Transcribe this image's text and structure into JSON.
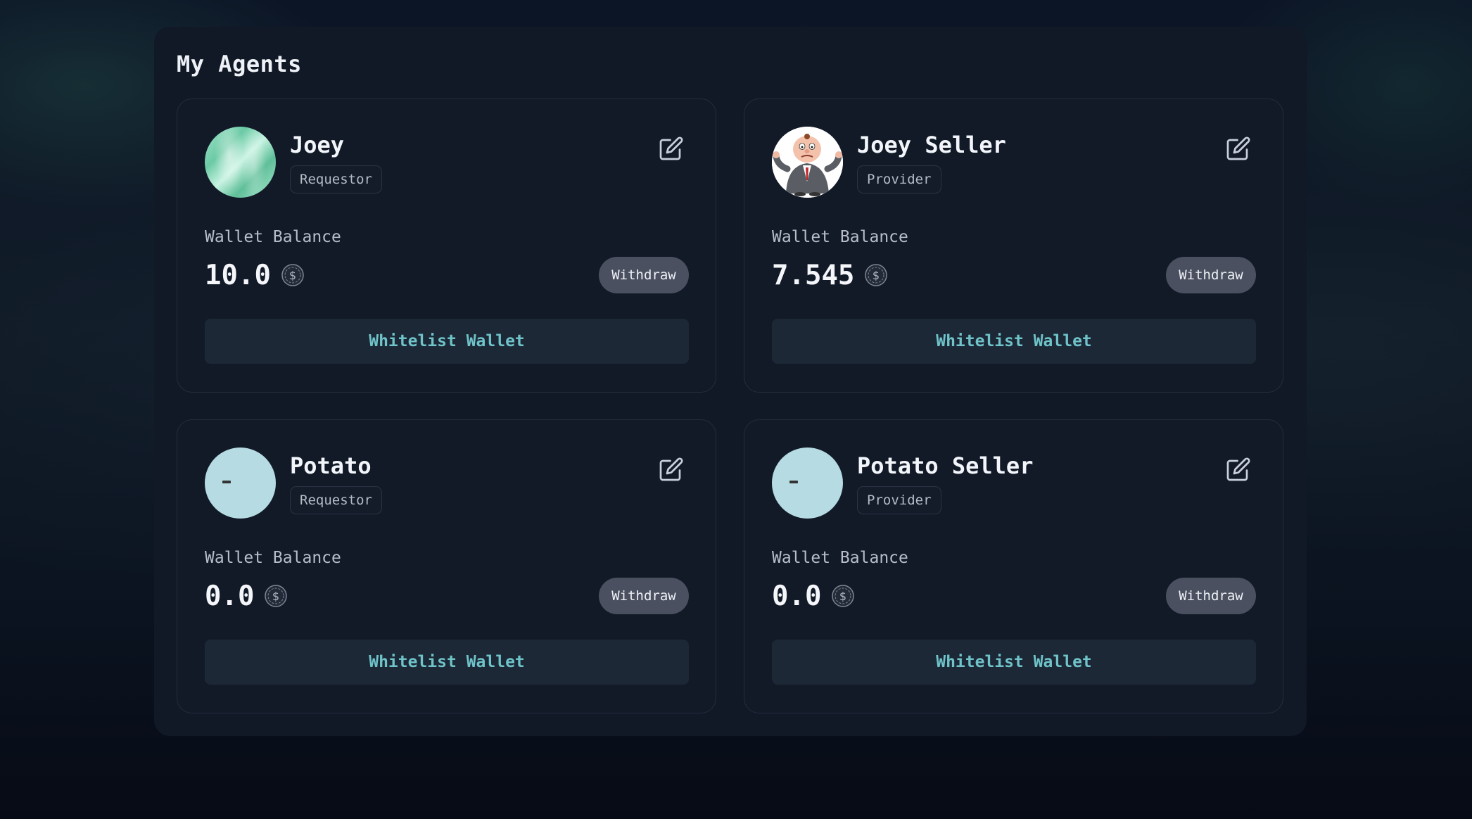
{
  "page": {
    "title": "My Agents"
  },
  "icons": {
    "edit": "edit-icon",
    "currency": "dollar-coin-icon"
  },
  "colors": {
    "accent": "#6fc3c9",
    "withdraw_bg": "#4a5060",
    "whitelist_bg": "#1c2836"
  },
  "agents": [
    {
      "name": "Joey",
      "role": "Requestor",
      "wallet_label": "Wallet Balance",
      "balance": "10.0",
      "withdraw_label": "Withdraw",
      "whitelist_label": "Whitelist Wallet"
    },
    {
      "name": "Joey Seller",
      "role": "Provider",
      "wallet_label": "Wallet Balance",
      "balance": "7.545",
      "withdraw_label": "Withdraw",
      "whitelist_label": "Whitelist Wallet"
    },
    {
      "name": "Potato",
      "role": "Requestor",
      "wallet_label": "Wallet Balance",
      "balance": "0.0",
      "withdraw_label": "Withdraw",
      "whitelist_label": "Whitelist Wallet"
    },
    {
      "name": "Potato Seller",
      "role": "Provider",
      "wallet_label": "Wallet Balance",
      "balance": "0.0",
      "withdraw_label": "Withdraw",
      "whitelist_label": "Whitelist Wallet"
    }
  ]
}
